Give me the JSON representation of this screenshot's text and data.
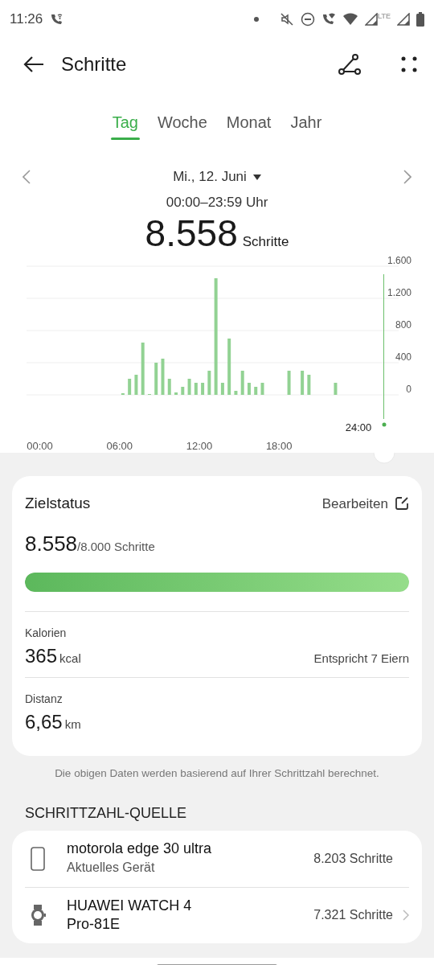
{
  "status_bar": {
    "time": "11:26",
    "network_label": "LTE"
  },
  "header": {
    "title": "Schritte"
  },
  "tabs": [
    {
      "label": "Tag",
      "selected": true
    },
    {
      "label": "Woche",
      "selected": false
    },
    {
      "label": "Monat",
      "selected": false
    },
    {
      "label": "Jahr",
      "selected": false
    }
  ],
  "date": {
    "label": "Mi., 12. Juni",
    "range": "00:00–23:59 Uhr"
  },
  "total": {
    "value": "8.558",
    "unit": "Schritte"
  },
  "chart": {
    "current_label": "24:00",
    "chart_data": {
      "type": "bar",
      "grid": true,
      "x": [
        6.25,
        6.75,
        7.25,
        7.75,
        8.25,
        8.75,
        9.25,
        9.75,
        10.25,
        10.75,
        11.25,
        11.75,
        12.25,
        12.75,
        13.25,
        13.75,
        14.25,
        14.75,
        15.25,
        15.75,
        16.25,
        16.75,
        18.75,
        19.75,
        20.25,
        22.25
      ],
      "values": [
        20,
        200,
        250,
        650,
        10,
        400,
        450,
        200,
        30,
        100,
        200,
        150,
        150,
        300,
        1450,
        150,
        700,
        50,
        300,
        150,
        100,
        150,
        300,
        300,
        250,
        150
      ],
      "xlim": [
        -1,
        27
      ],
      "ylim": [
        0,
        1600
      ],
      "xticks": [
        {
          "value": 0,
          "label": "00:00"
        },
        {
          "value": 6,
          "label": "06:00"
        },
        {
          "value": 12,
          "label": "12:00"
        },
        {
          "value": 18,
          "label": "18:00"
        }
      ],
      "yticks": [
        {
          "value": 0,
          "label": "0"
        },
        {
          "value": 400,
          "label": "400"
        },
        {
          "value": 800,
          "label": "800"
        },
        {
          "value": 1200,
          "label": "1.200"
        },
        {
          "value": 1600,
          "label": "1.600"
        }
      ]
    }
  },
  "goal": {
    "title": "Zielstatus",
    "edit_label": "Bearbeiten",
    "value": "8.558",
    "target": "/8.000 Schritte",
    "level": 1
  },
  "stats": [
    {
      "label": "Kalorien",
      "value": "365",
      "unit": "kcal",
      "note": "Entspricht 7 Eiern"
    },
    {
      "label": "Distanz",
      "value": "6,65",
      "unit": "km"
    }
  ],
  "footnote": "Die obigen Daten werden basierend auf Ihrer Schrittzahl berechnet.",
  "sources_title": "SCHRITTZAHL-QUELLE",
  "sources": [
    {
      "kind": "phone",
      "name": "motorola edge 30 ultra",
      "subtitle": "Aktuelles Gerät",
      "steps": "8.203 Schritte",
      "openable": false
    },
    {
      "kind": "watch",
      "name": "HUAWEI WATCH 4 Pro-81E",
      "steps": "7.321 Schritte",
      "openable": true
    }
  ]
}
